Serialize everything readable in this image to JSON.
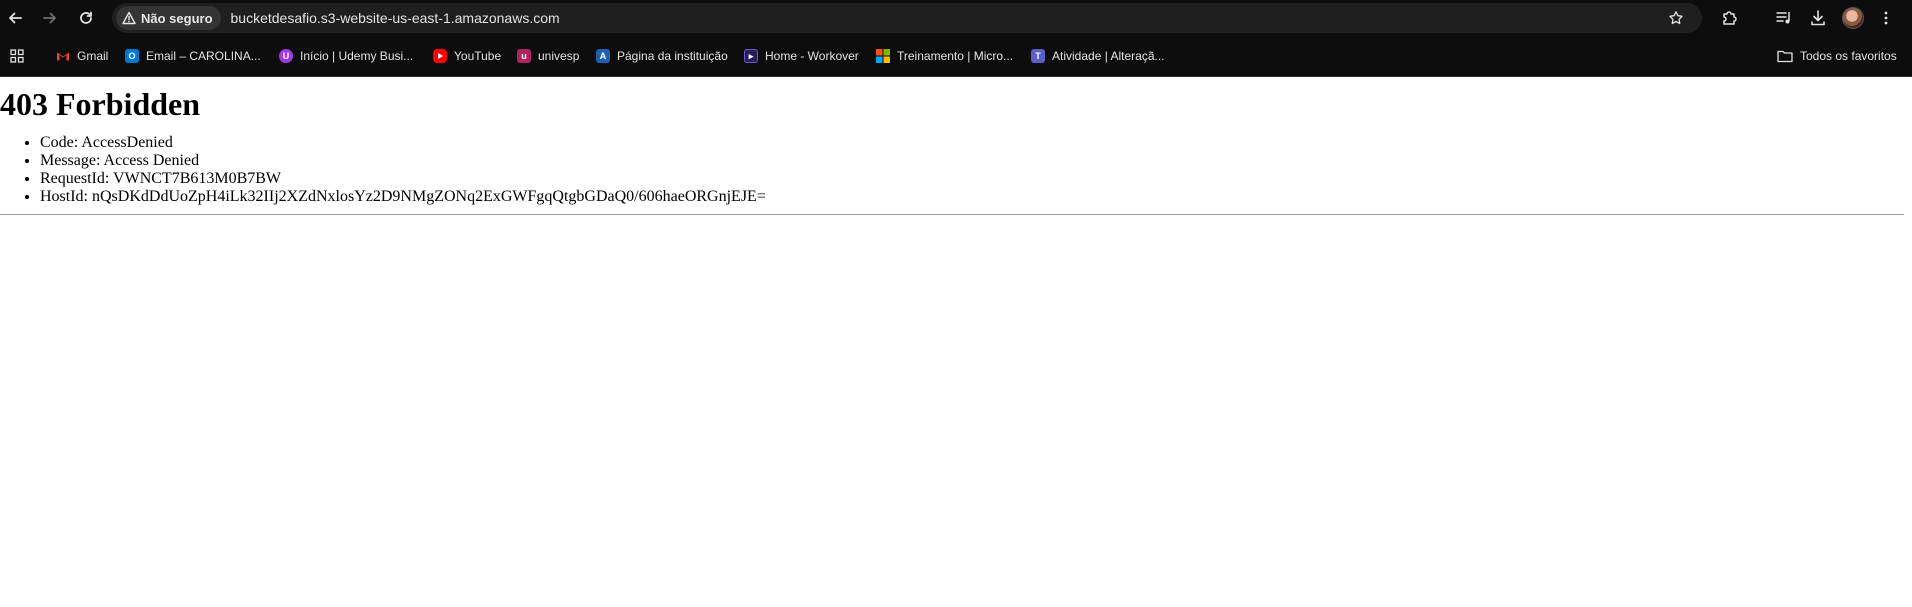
{
  "browser": {
    "security_label": "Não seguro",
    "url": "bucketdesafio.s3-website-us-east-1.amazonaws.com"
  },
  "bookmarks": {
    "items": [
      {
        "label": "Gmail",
        "color": "#ea4335",
        "icon": "gmail-icon"
      },
      {
        "label": "Email – CAROLINA...",
        "color": "#0078d4",
        "icon": "outlook-icon"
      },
      {
        "label": "Início | Udemy Busi...",
        "color": "#a435f0",
        "icon": "udemy-icon"
      },
      {
        "label": "YouTube",
        "color": "#ff0000",
        "icon": "youtube-icon"
      },
      {
        "label": "univesp",
        "color": "#b0235f",
        "icon": "univesp-icon"
      },
      {
        "label": "Página da instituição",
        "color": "#1e5fae",
        "icon": "institution-icon"
      },
      {
        "label": "Home - Workover",
        "color": "#3a2a7a",
        "icon": "workover-icon"
      },
      {
        "label": "Treinamento | Micro...",
        "color": "#f25022",
        "icon": "microsoft-icon"
      },
      {
        "label": "Atividade | Alteraçã...",
        "color": "#5b5fc7",
        "icon": "teams-icon"
      }
    ],
    "all_bookmarks_label": "Todos os favoritos"
  },
  "page": {
    "title": "403 Forbidden",
    "details": [
      "Code: AccessDenied",
      "Message: Access Denied",
      "RequestId: VWNCT7B613M0B7BW",
      "HostId: nQsDKdDdUoZpH4iLk32IIj2XZdNxlosYz2D9NMgZONq2ExGWFgqQtgbGDaQ0/606haeORGnjEJE="
    ]
  }
}
